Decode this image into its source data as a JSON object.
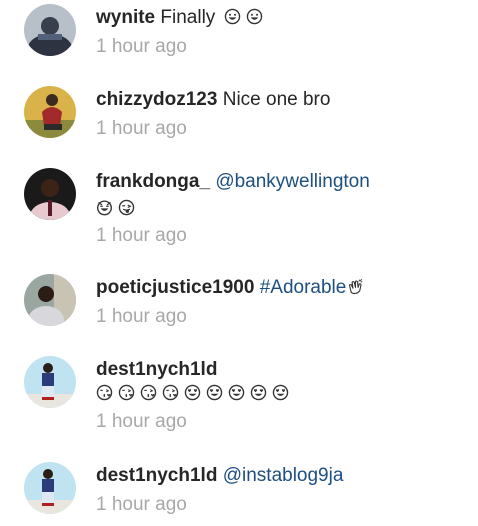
{
  "comments": [
    {
      "username": "wynite",
      "text": "Finally",
      "link": "",
      "emojis": [
        "grin-outline-icon",
        "grin-outline-icon"
      ],
      "time": "1 hour ago",
      "avatar_colors": [
        "#b7c0c8",
        "#2d3340"
      ]
    },
    {
      "username": "chizzydoz123",
      "text": "Nice one bro",
      "link": "",
      "emojis": [],
      "time": "1 hour ago",
      "avatar_colors": [
        "#d9b24a",
        "#a22a2a"
      ]
    },
    {
      "username": "frankdonga_",
      "text": "",
      "link": "@bankywellington",
      "emojis": [
        "laughing-face-icon",
        "tongue-wink-icon"
      ],
      "time": "1 hour ago",
      "avatar_colors": [
        "#1a1a1a",
        "#e8c9cf"
      ]
    },
    {
      "username": "poeticjustice1900",
      "text": "",
      "link": "#Adorable",
      "emojis": [
        "clapping-hands-icon"
      ],
      "time": "1 hour ago",
      "avatar_colors": [
        "#9aa6a0",
        "#d8d8dc"
      ]
    },
    {
      "username": "dest1nych1ld",
      "text": "",
      "link": "",
      "emojis": [
        "kiss-face-icon",
        "kiss-face-icon",
        "kiss-face-icon",
        "kiss-face-icon",
        "heart-eyes-icon",
        "heart-eyes-icon",
        "heart-eyes-icon",
        "heart-eyes-icon",
        "heart-eyes-icon"
      ],
      "time": "1 hour ago",
      "avatar_colors": [
        "#bfe3f0",
        "#2a3d7a"
      ]
    },
    {
      "username": "dest1nych1ld",
      "text": "",
      "link": "@instablog9ja",
      "emojis": [],
      "time": "1 hour ago",
      "avatar_colors": [
        "#bfe3f0",
        "#2a3d7a"
      ]
    }
  ]
}
